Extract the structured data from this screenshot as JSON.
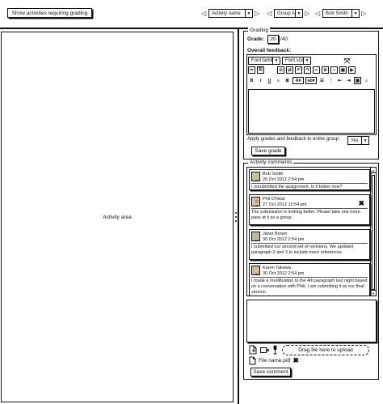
{
  "toolbar": {
    "show_activities_button": "Show activities requiring grading",
    "activity_select": "Activity name",
    "group_select": "Group A",
    "user_select": "Bob Smith"
  },
  "activity_area": {
    "label": "Activity area"
  },
  "grading": {
    "legend": "Grading",
    "grade_label": "Grade:",
    "grade_value": "20",
    "grade_max": "/40",
    "overall_feedback_label": "Overall feedback:",
    "font_family": "Font family",
    "font_size": "Font size",
    "apply_label": "Apply grades and feedback to entire group:",
    "apply_value": "Yes",
    "save_button": "Save grade"
  },
  "comments": {
    "legend": "Activity comments",
    "items": [
      {
        "author": "Bob Smith",
        "date": "26 Oct 2012 2:54 pm",
        "text": "I resubmitted the assignment.  Is it better now?",
        "closable": false
      },
      {
        "author": "Phil O'Neal",
        "date": "27 Oct 2012 12:54 pm",
        "text": "The submission is looking better. Please take one more pass at it as a group.",
        "closable": true
      },
      {
        "author": "Janet Brown",
        "date": "30 Oct 2012 2:54 pm",
        "text": "I submitted our second set of revisions. We updated paragraph 2 and 3 to include more references.",
        "closable": false
      },
      {
        "author": "Karen Takawa",
        "date": "30 Oct 2012 2:54 pm",
        "text": "I made a modification to the 4th paragraph last night based on a conversation with Phill. I am submitting it as our final version.",
        "closable": false
      }
    ],
    "drop_zone": "Drag file here to upload",
    "file_name": "File name.pdf",
    "save_button": "Save comment"
  }
}
